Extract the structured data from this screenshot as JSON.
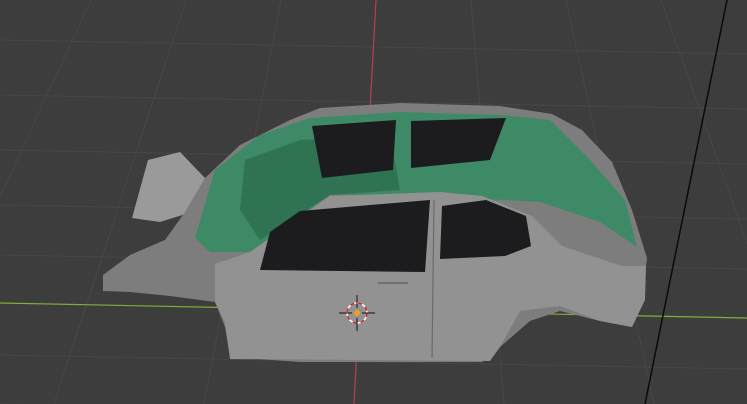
{
  "viewport": {
    "type": "3d-viewport",
    "object": "car-body-model",
    "colors": {
      "background": "#3d3d3d",
      "grid": "#484848",
      "x_axis": "#7fae3a",
      "y_axis": "#b3404f",
      "body": "#8c8c8c",
      "body_light": "#999999",
      "interior": "#3e8a66",
      "window": "#1c1c1e",
      "cursor_dot": "#f0a020"
    },
    "icons": [
      "3d-cursor-icon"
    ]
  }
}
